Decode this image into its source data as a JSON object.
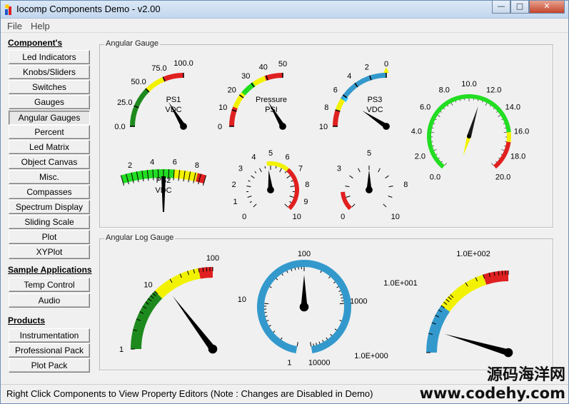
{
  "window": {
    "title": "Iocomp Components Demo - v2.00",
    "minimize_glyph": "—",
    "maximize_glyph": "□",
    "close_glyph": "✕"
  },
  "menu": {
    "file": "File",
    "help": "Help"
  },
  "sidebar": {
    "components_heading": "Component's",
    "components": [
      "Led Indicators",
      "Knobs/Sliders",
      "Switches",
      "Gauges",
      "Angular Gauges",
      "Percent",
      "Led Matrix",
      "Object Canvas",
      "Misc.",
      "Compasses",
      "Spectrum Display",
      "Sliding Scale",
      "Plot",
      "XYPlot"
    ],
    "active_component": "Angular Gauges",
    "samples_heading": "Sample Applications",
    "samples": [
      "Temp Control",
      "Audio"
    ],
    "products_heading": "Products",
    "products": [
      "Instrumentation Pack",
      "Professional Pack",
      "Plot Pack"
    ]
  },
  "groups": {
    "angular": "Angular Gauge",
    "log": "Angular Log Gauge"
  },
  "gauges": {
    "ps1": {
      "ticks": [
        "0.0",
        "25.0",
        "50.0",
        "75.0",
        "100.0"
      ],
      "title1": "PS1",
      "title2": "VDC",
      "value": 65
    },
    "pressure": {
      "ticks": [
        "0",
        "10",
        "20",
        "30",
        "40",
        "50"
      ],
      "title1": "Pressure",
      "title2": "PSI",
      "value": 33
    },
    "ps3": {
      "ticks": [
        "10",
        "8",
        "6",
        "4",
        "2",
        "0"
      ],
      "title1": "PS3",
      "title2": "VDC",
      "value": 6.3
    },
    "dial12": {
      "ticks": [
        "0.0",
        "2.0",
        "4.0",
        "6.0",
        "8.0",
        "10.0",
        "12.0",
        "14.0",
        "16.0",
        "18.0",
        "20.0"
      ],
      "value": 11.2
    },
    "ps2": {
      "ticks": [
        "2",
        "4",
        "6",
        "8"
      ],
      "title1": "PS2",
      "title2": "VDC",
      "value": 5.0
    },
    "small_a": {
      "ticks": [
        "0",
        "1",
        "2",
        "3",
        "4",
        "5",
        "6",
        "7",
        "8",
        "9",
        "10"
      ],
      "value": 4.8
    },
    "small_b": {
      "ticks": [
        "0",
        "3",
        "5",
        "8",
        "10"
      ],
      "value": 5.0
    }
  },
  "log_gauges": {
    "log1": {
      "ticks": [
        "1",
        "10",
        "100"
      ],
      "value": 15
    },
    "log2": {
      "ticks": [
        "1",
        "10",
        "100",
        "1000",
        "10000"
      ],
      "value": 100
    },
    "log3": {
      "ticks": [
        "1.0E+000",
        "1.0E+001",
        "1.0E+002"
      ],
      "value": 2.3
    }
  },
  "status": {
    "text": "Right Click Components to View Property Editors (Note : Changes are Disabled in Demo)"
  },
  "watermark": {
    "line1": "源码海洋网",
    "line2": "www.codehy.com"
  },
  "colors": {
    "green": "#1e8a1e",
    "lime": "#22dd22",
    "yellow": "#f2f200",
    "red": "#e02020",
    "blue": "#3399cc",
    "needle": "#000000"
  }
}
